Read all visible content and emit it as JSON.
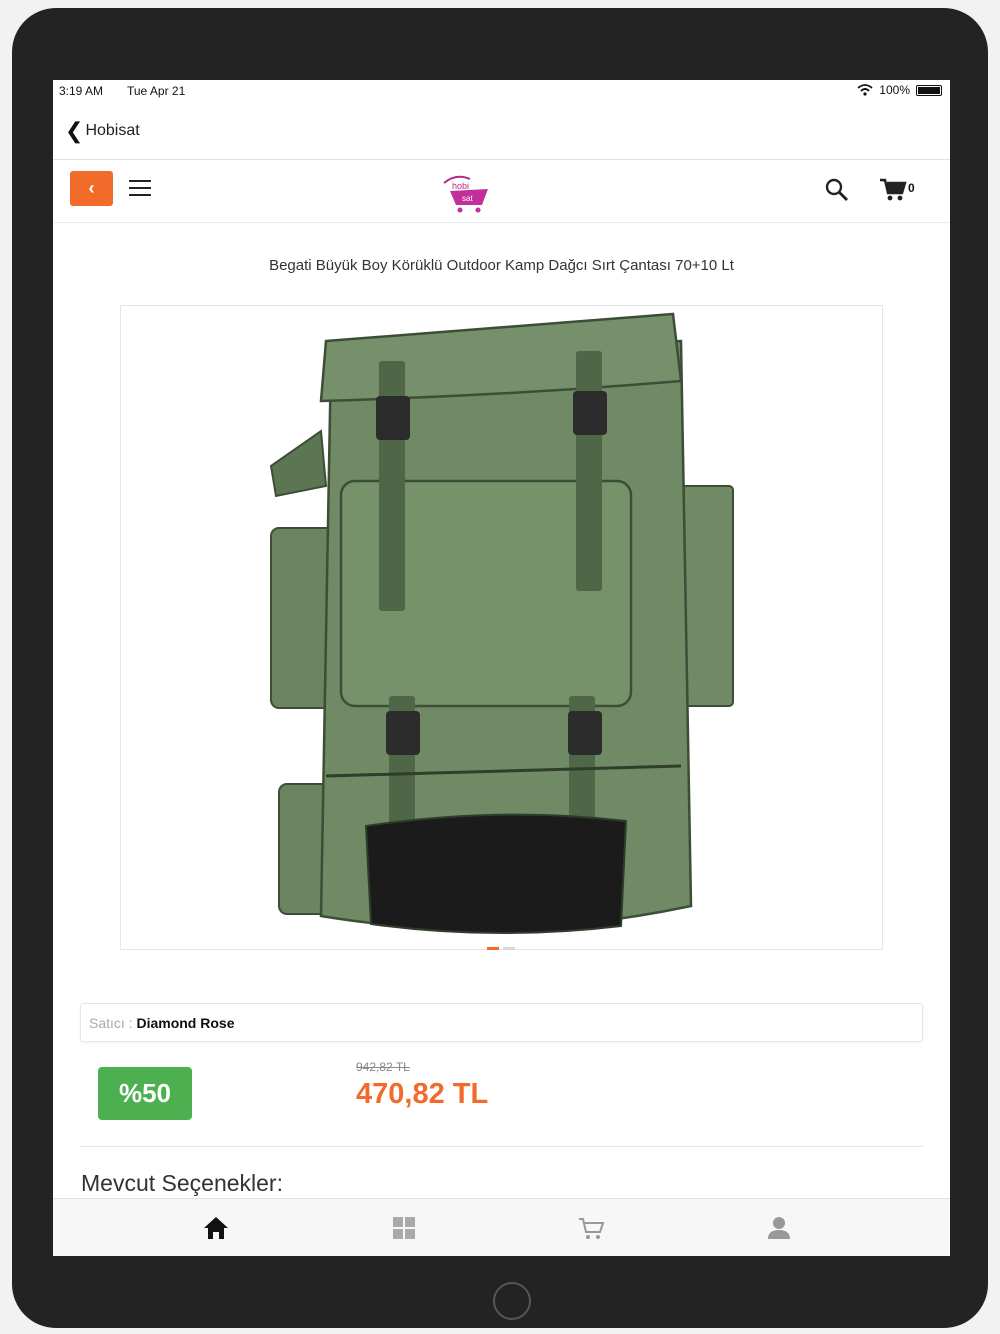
{
  "status_bar": {
    "time": "3:19 AM",
    "date": "Tue Apr 21",
    "battery": "100%"
  },
  "app_nav": {
    "back_label": "Hobisat"
  },
  "store_toolbar": {
    "cart_count": "0",
    "logo_name": "hobisat-logo"
  },
  "product": {
    "title": "Begati Büyük Boy Körüklü Outdoor Kamp Dağcı Sırt Çantası 70+10 Lt",
    "image_icon": "backpack-image",
    "slides": {
      "count": 2,
      "active_index": 0
    },
    "seller_prefix": "Satıcı :",
    "seller_name": "Diamond Rose",
    "discount": "%50",
    "old_price": "942,82 TL",
    "new_price": "470,82 TL",
    "options_heading": "Mevcut Seçenekler:"
  },
  "tab_bar": {
    "tabs": [
      {
        "icon": "home-icon",
        "active": true
      },
      {
        "icon": "categories-icon",
        "active": false
      },
      {
        "icon": "cart-icon",
        "active": false
      },
      {
        "icon": "user-icon",
        "active": false
      }
    ]
  },
  "colors": {
    "accent_orange": "#f26b2a",
    "discount_green": "#4cb050",
    "backpack_green": "#6f8a62"
  }
}
